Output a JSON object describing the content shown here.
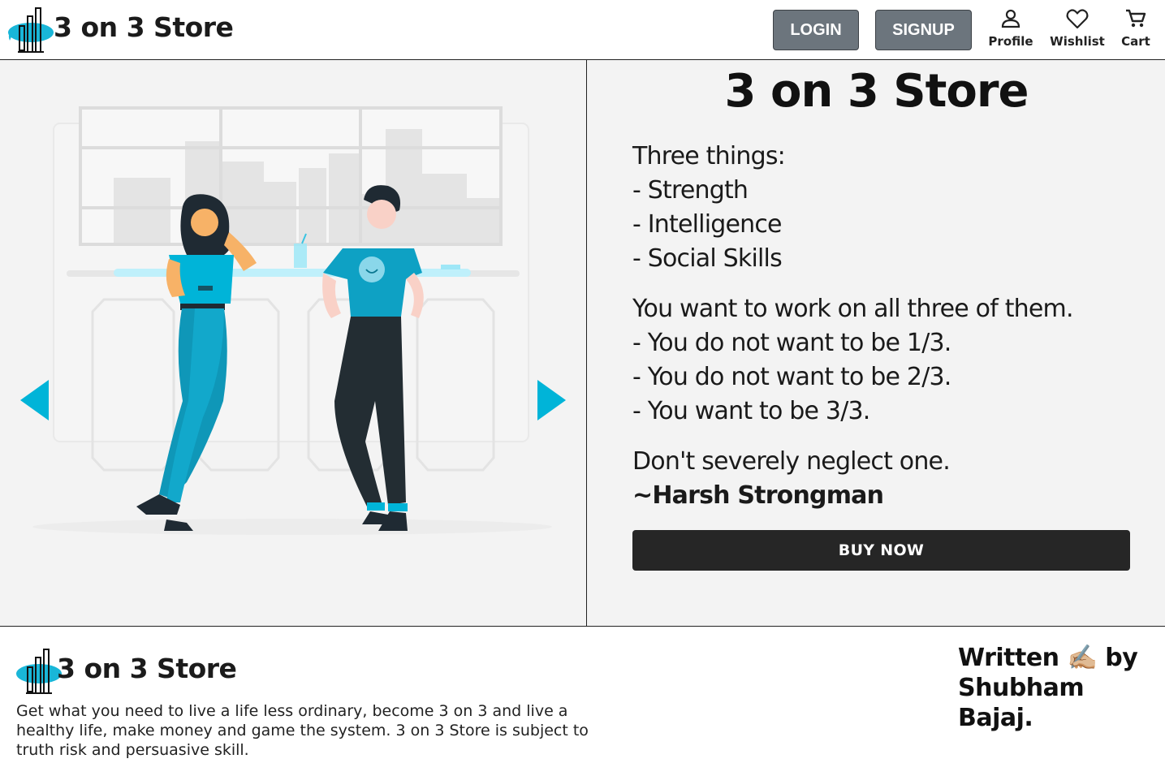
{
  "header": {
    "logo_text": "3 on 3 Store",
    "login_label": "LOGIN",
    "signup_label": "SIGNUP",
    "nav": [
      {
        "label": "Profile",
        "icon": "person-icon"
      },
      {
        "label": "Wishlist",
        "icon": "heart-icon"
      },
      {
        "label": "Cart",
        "icon": "cart-icon"
      }
    ]
  },
  "carousel": {
    "prev_icon": "triangle-left-icon",
    "next_icon": "triangle-right-icon",
    "image": "people-chatting-at-bar-illustration"
  },
  "product": {
    "title": "3 on 3 Store",
    "lines_1": [
      "Three things:",
      "- Strength",
      "- Intelligence",
      "- Social Skills"
    ],
    "lines_2": [
      "You want to work on all three of them.",
      "- You do not want to be 1/3.",
      "- You do not want to be 2/3.",
      "- You want to be 3/3."
    ],
    "closing": "Don't severely neglect one.",
    "author": "~Harsh Strongman",
    "buy_label": "BUY NOW"
  },
  "footer": {
    "logo_text": "3 on 3 Store",
    "about": "Get what you need to live a life less ordinary, become 3 on 3 and live a healthy life, make money and game the system. 3 on 3 Store is subject to truth risk and persuasive skill.",
    "credit_1": "Written",
    "credit_emoji": "✍🏼",
    "credit_2": "by",
    "credit_3": "Shubham Bajaj."
  },
  "colors": {
    "accent": "#00b4d8",
    "auth_button": "#6c757d",
    "buy_button": "#262626",
    "hero_bg": "#f3f3f3"
  }
}
